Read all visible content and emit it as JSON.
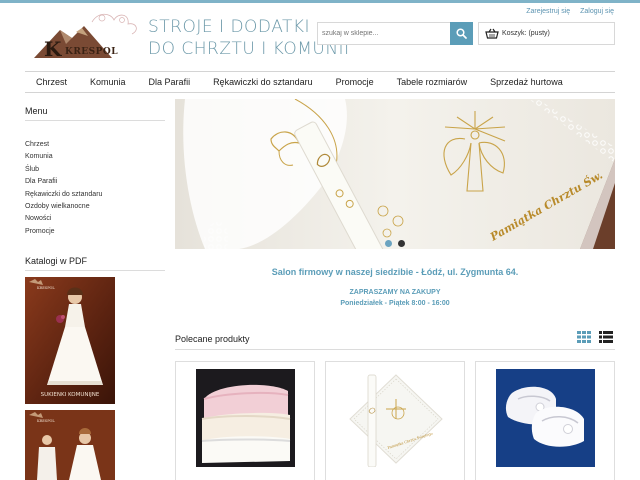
{
  "brand": {
    "logo_text": "KRESPOL",
    "tagline_line1": "STROJE I DODATKI",
    "tagline_line2": "DO CHRZTU I KOMUNII"
  },
  "header": {
    "register_link": "Zarejestruj się",
    "login_link": "Zaloguj się",
    "search_placeholder": "szukaj w sklepie...",
    "cart_label": "Koszyk: (pusty)"
  },
  "nav": {
    "items": [
      "Chrzest",
      "Komunia",
      "Dla Parafii",
      "Rękawiczki do sztandaru",
      "Promocje",
      "Tabele rozmiarów",
      "Sprzedaż hurtowa"
    ]
  },
  "sidebar": {
    "menu_title": "Menu",
    "menu_items": [
      "Chrzest",
      "Komunia",
      "Ślub",
      "Dla Parafii",
      "Rękawiczki do sztandaru",
      "Ozdoby wielkanocne",
      "Nowości",
      "Promocje"
    ],
    "catalogs_title": "Katalogi w PDF",
    "catalog1_caption": "SUKIENKI KOMUNIJNE",
    "catalog_logo_text": "KRESPOL"
  },
  "slider": {
    "embroidery_text": "Pamiątka Chrztu Św.",
    "slides_count": 2,
    "active_slide": 1
  },
  "info": {
    "salon_text": "Salon firmowy w naszej siedzibie - Łódź, ul. Zygmunta 64.",
    "invite_text": "ZAPRASZAMY NA ZAKUPY",
    "hours_text": "Poniedziałek - Piątek 8:00 - 16:00"
  },
  "recommended": {
    "title": "Polecane produkty",
    "view_grid_icon": "grid-view-icon",
    "view_list_icon": "list-view-icon",
    "product2_label": "Pamiątka Chrztu Świętego"
  },
  "colors": {
    "accent": "#5b9db8",
    "tagline": "#6e9aaa",
    "top_line": "#7fb3c8"
  }
}
